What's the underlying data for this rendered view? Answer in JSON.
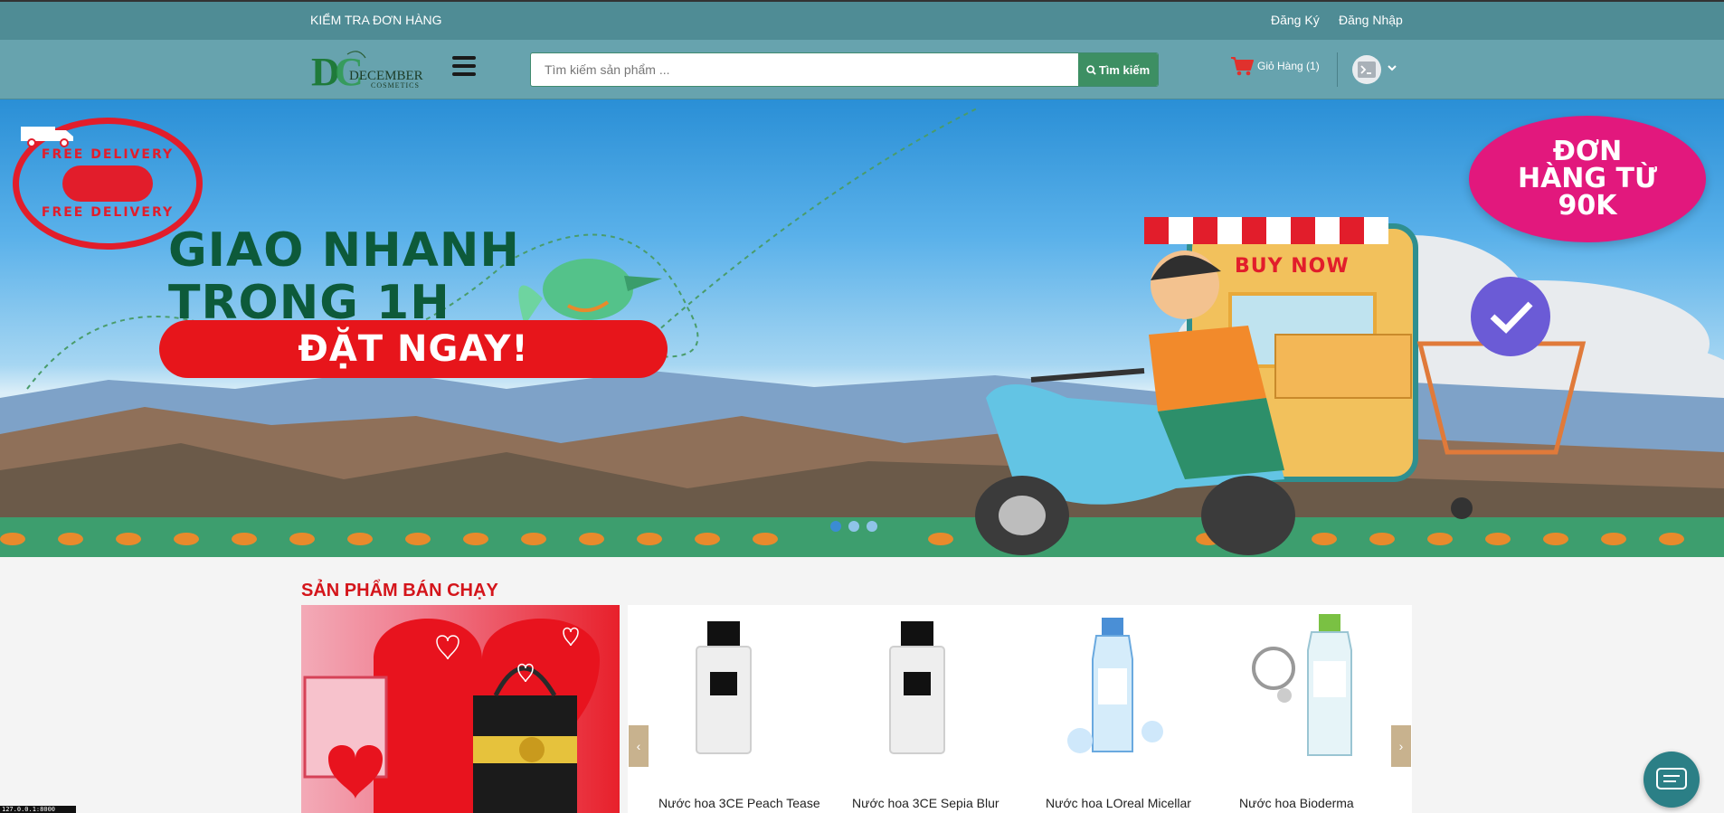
{
  "topbar": {
    "check_order": "KIỂM TRA ĐƠN HÀNG",
    "register": "Đăng Ký",
    "login": "Đăng Nhập"
  },
  "header": {
    "logo_brand": "DECEMBER",
    "logo_sub": "COSMETICS",
    "search_placeholder": "Tìm kiếm sản phẩm ...",
    "search_button": "Tìm kiếm",
    "cart_label": "Giỏ Hàng (1)"
  },
  "banner": {
    "stamp_text_top": "FREE DELIVERY",
    "stamp_text_bottom": "FREE DELIVERY",
    "headline_line1": "GIAO NHANH",
    "headline_line2": "TRONG 1H",
    "cta": "ĐẶT NGAY!",
    "promo_line1": "ĐƠN",
    "promo_line2": "HÀNG TỪ",
    "promo_line3": "90K",
    "store_sign": "BUY NOW"
  },
  "bestsellers": {
    "title": "SẢN PHẨM BÁN CHẠY",
    "products": [
      {
        "name": "Nước hoa 3CE Peach Tease"
      },
      {
        "name": "Nước hoa 3CE Sepia Blur"
      },
      {
        "name": "Nước hoa LOreal Micellar"
      },
      {
        "name": "Nước hoa Bioderma"
      }
    ]
  },
  "statusbar": "127.0.0.1:8000",
  "colors": {
    "topbar": "#4f8c95",
    "header": "#67a3ae",
    "search_button": "#3d8f63",
    "accent_red": "#d4151b"
  }
}
